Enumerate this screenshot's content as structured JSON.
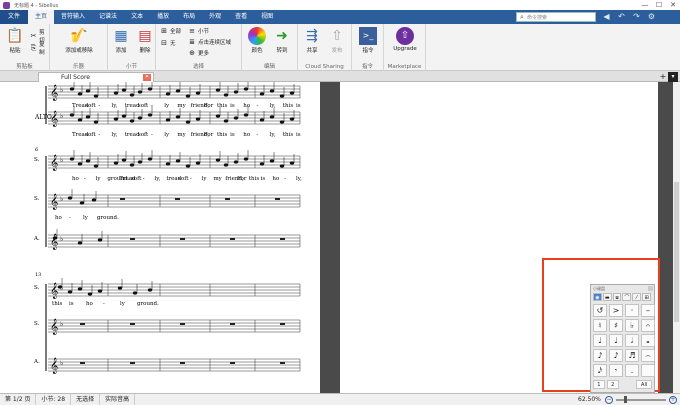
{
  "window": {
    "title": "无标题 4 - Sibelius",
    "controls": [
      "—",
      "☐",
      "✕"
    ]
  },
  "ribbon_tabs": [
    "文件",
    "主页",
    "音符输入",
    "记谱法",
    "文本",
    "播放",
    "布局",
    "外观",
    "查看",
    "视图"
  ],
  "search": {
    "placeholder": "命令搜索"
  },
  "ribbon": {
    "clipboard": {
      "paste": "粘贴",
      "cut": "剪切",
      "copy": "复制",
      "label": "剪贴板"
    },
    "instruments": {
      "add_remove": "添加或移除",
      "label": "乐器"
    },
    "bars": {
      "add": "添加",
      "delete": "删除",
      "label": "小节"
    },
    "select": {
      "all": "全部",
      "none": "无",
      "more": "更多",
      "bar": "小节",
      "passage": "点击连续区域",
      "label": "选择"
    },
    "edit": {
      "color": "颜色",
      "flip": "转到",
      "label": "编辑"
    },
    "cloud": {
      "share": "共享",
      "publish": "发布",
      "label": "Cloud Sharing"
    },
    "plugins": {
      "command": "指令",
      "label": "指令"
    },
    "marketplace": {
      "upgrade": "Upgrade",
      "label": "Marketplace"
    }
  },
  "doc_tab": {
    "label": "Full Score"
  },
  "score": {
    "system1": {
      "lyrics_top": [
        "Tread",
        "soft",
        "-",
        "ly,",
        "tread",
        "soft",
        "-",
        "ly",
        "my",
        "friend,",
        "For",
        "this",
        "is",
        "ho",
        "-",
        "ly,",
        "this",
        "is"
      ],
      "alto_label": "ALTO",
      "lyrics_alto": [
        "Tread",
        "soft",
        "-",
        "ly,",
        "tread",
        "soft",
        "-",
        "ly",
        "my",
        "friend,",
        "For",
        "this",
        "is",
        "ho",
        "-",
        "ly,",
        "this",
        "is"
      ]
    },
    "system2": {
      "bar_number": "6",
      "staff_labels": [
        "S.",
        "S.",
        "A."
      ],
      "lyrics_1": [
        "ho",
        "-",
        "ly",
        "ground.",
        "Tread",
        "soft",
        "-",
        "ly,",
        "tread",
        "soft",
        "-",
        "ly",
        "my",
        "friend,",
        "For",
        "this",
        "is",
        "ho",
        "-",
        "ly,"
      ],
      "lyrics_2": [
        "ho",
        "-",
        "ly",
        "ground."
      ],
      "lyrics_3": []
    },
    "system3": {
      "bar_number": "13",
      "staff_labels": [
        "S.",
        "S.",
        "A."
      ],
      "lyrics_1": [
        "this",
        "is",
        "ho",
        "-",
        "ly",
        "ground."
      ]
    }
  },
  "keypad": {
    "title": "小键盘",
    "tabs": [
      "◉",
      "▬",
      "⧈",
      "⌒",
      "⁄",
      "⊞"
    ],
    "keys": [
      "↺",
      ">",
      "·",
      "–",
      "♮",
      "♯",
      "♭",
      "𝄐",
      "♩",
      "♩",
      "𝅗𝅥",
      "𝅝",
      "♪",
      "♪",
      "♬",
      "⌢",
      "𝅘𝅥𝅯",
      "𝄾",
      ".",
      ""
    ],
    "bottom": [
      "1",
      "2",
      "All"
    ]
  },
  "status": {
    "page": "第 1/2 页",
    "bar": "小节: 28",
    "selection": "无选择",
    "pitch": "实际音高",
    "zoom": "62.50%"
  }
}
